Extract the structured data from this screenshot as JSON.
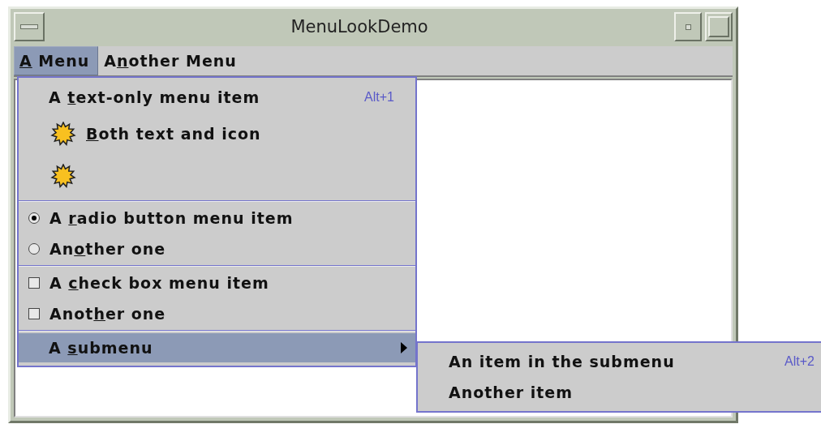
{
  "window": {
    "title": "MenuLookDemo"
  },
  "menu_bar": [
    {
      "mnemonic": "A",
      "after": " Menu",
      "selected": true
    },
    {
      "before": "A",
      "mnemonic": "n",
      "after": "other Menu",
      "selected": false
    }
  ],
  "menu": {
    "items": [
      {
        "kind": "text",
        "before": "A ",
        "mnemonic": "t",
        "after": "ext-only menu item",
        "accelerator": "Alt+1"
      },
      {
        "kind": "icon_text",
        "mnemonic": "B",
        "after": "oth text and icon"
      },
      {
        "kind": "icon"
      },
      {
        "kind": "separator"
      },
      {
        "kind": "radio",
        "before": "A ",
        "mnemonic": "r",
        "after": "adio button menu item",
        "checked": true
      },
      {
        "kind": "radio",
        "before": "An",
        "mnemonic": "o",
        "after": "ther one",
        "checked": false
      },
      {
        "kind": "separator"
      },
      {
        "kind": "check",
        "before": "A ",
        "mnemonic": "c",
        "after": "heck box menu item",
        "checked": false
      },
      {
        "kind": "check",
        "before": "Anot",
        "mnemonic": "h",
        "after": "er one",
        "checked": false
      },
      {
        "kind": "separator"
      },
      {
        "kind": "submenu",
        "before": "A ",
        "mnemonic": "s",
        "after": "ubmenu",
        "selected": true
      }
    ]
  },
  "submenu": {
    "items": [
      {
        "before": "An item in the submenu",
        "accelerator": "Alt+2"
      },
      {
        "before": "Another item"
      }
    ]
  }
}
